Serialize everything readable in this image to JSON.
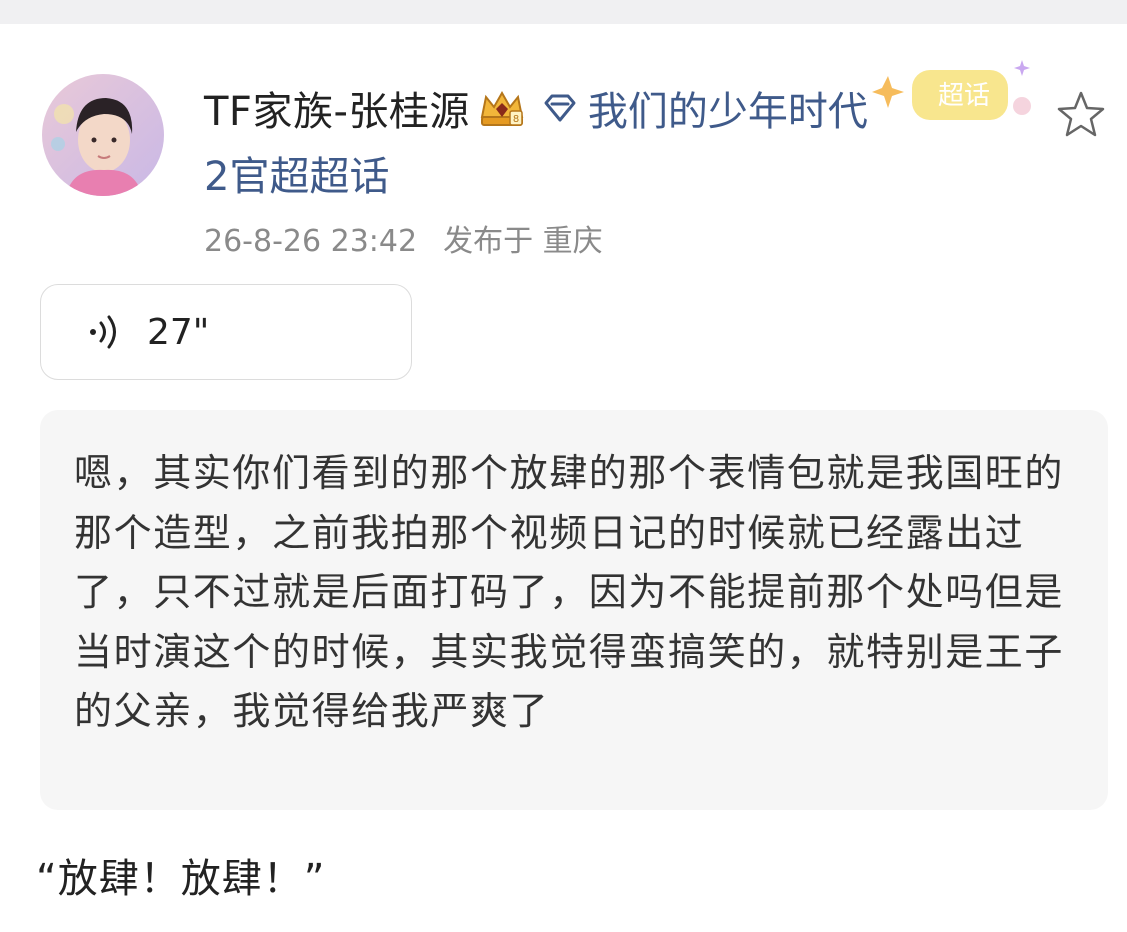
{
  "post": {
    "author_name": "TF家族-张桂源",
    "supertopic_name": "我们的少年时代",
    "supertopic_rank": "2官超超话",
    "timestamp": "26-8-26 23:42",
    "location": "发布于 重庆",
    "sticker_text": "超话"
  },
  "voice": {
    "duration": "27\""
  },
  "transcript": {
    "text": "嗯，其实你们看到的那个放肆的那个表情包就是我国旺的那个造型，之前我拍那个视频日记的时候就已经露出过了，只不过就是后面打码了，因为不能提前那个处吗但是当时演这个的时候，其实我觉得蛮搞笑的，就特别是王子的父亲，我觉得给我严爽了"
  },
  "caption": {
    "text": "“放肆！放肆！”"
  },
  "icons": {
    "avatar": "user-avatar",
    "crown": "crown-badge-icon",
    "supertopic": "diamond-icon",
    "follow": "star-icon",
    "voice": "sound-wave-icon"
  },
  "colors": {
    "topic_link": "#3f5a8a",
    "meta_gray": "#8a8a8a",
    "quote_bg": "#f6f6f6",
    "text": "#222222"
  }
}
